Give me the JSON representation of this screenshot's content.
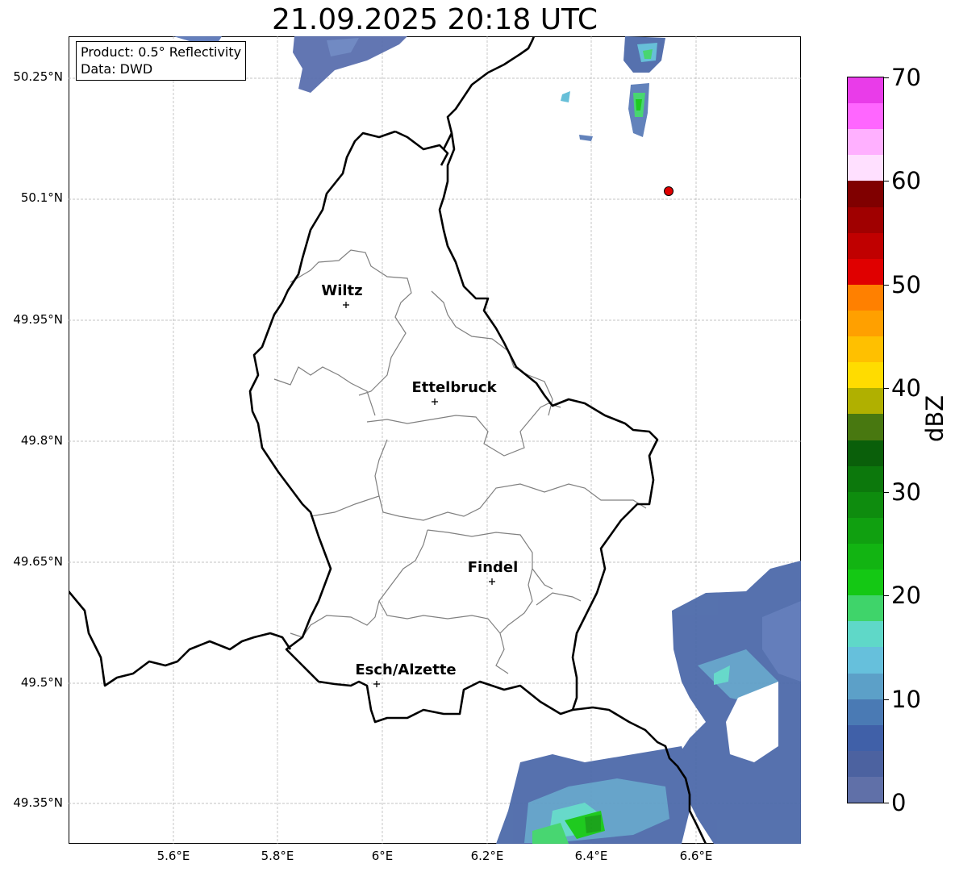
{
  "title": "21.09.2025 20:18 UTC",
  "info": {
    "product": "Product: 0.5° Reflectivity",
    "data": "Data: DWD"
  },
  "lat_labels": [
    "50.25°N",
    "50.1°N",
    "49.95°N",
    "49.8°N",
    "49.65°N",
    "49.5°N",
    "49.35°N"
  ],
  "lon_labels": [
    "5.6°E",
    "5.8°E",
    "6°E",
    "6.2°E",
    "6.4°E",
    "6.6°E"
  ],
  "cities": [
    {
      "name": "Wiltz"
    },
    {
      "name": "Ettelbruck"
    },
    {
      "name": "Findel"
    },
    {
      "name": "Esch/Alzette"
    }
  ],
  "colorbar": {
    "label": "dBZ",
    "ticks": [
      "70",
      "60",
      "50",
      "40",
      "30",
      "20",
      "10",
      "0"
    ],
    "colors_top_to_bottom": [
      "#e93ce9",
      "#ff66ff",
      "#ffb0ff",
      "#ffe0ff",
      "#800000",
      "#a00000",
      "#c00000",
      "#e00000",
      "#ff8000",
      "#ffa000",
      "#ffc000",
      "#ffdc00",
      "#b0b000",
      "#487810",
      "#0a5f0a",
      "#0c780c",
      "#0e8c0e",
      "#10a010",
      "#12b412",
      "#14c814",
      "#3fd46a",
      "#5fd8c8",
      "#66c0dc",
      "#5ca0c8",
      "#4a7ab4",
      "#4060a8",
      "#4c62a0",
      "#6070a8"
    ],
    "max_dbz": 70,
    "min_dbz": 0
  },
  "colors": {
    "border": "#000000",
    "cantons": "#808080",
    "gridline": "#b0b0b0",
    "marker": "#e00000"
  }
}
